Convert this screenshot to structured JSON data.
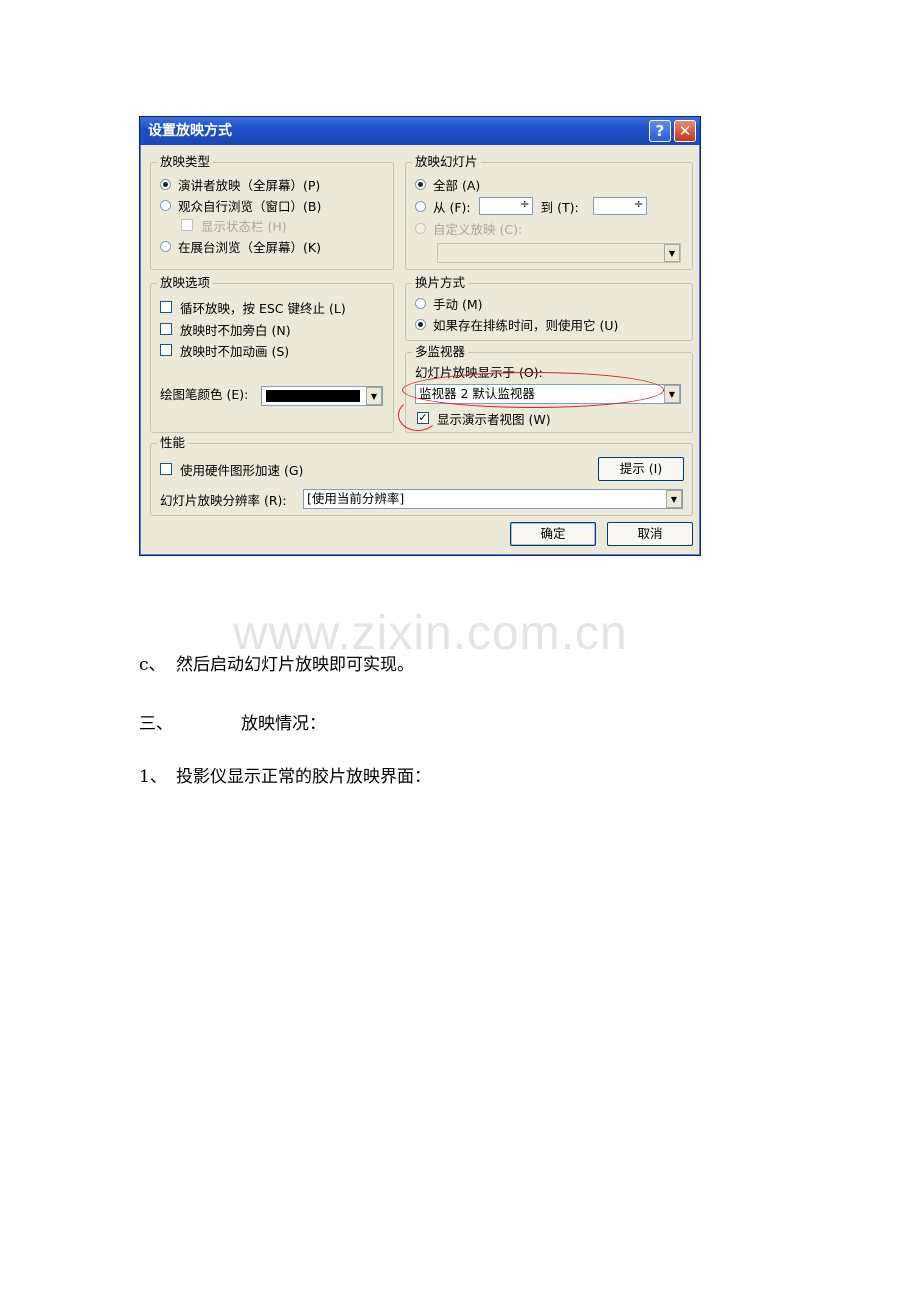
{
  "dialog": {
    "title": "设置放映方式",
    "help_glyph": "?",
    "close_glyph": "✕",
    "show_type": {
      "legend": "放映类型",
      "presenter": "演讲者放映（全屏幕）(P)",
      "browsed": "观众自行浏览（窗口）(B)",
      "show_status_bar": "显示状态栏 (H)",
      "kiosk": "在展台浏览（全屏幕）(K)"
    },
    "show_slides": {
      "legend": "放映幻灯片",
      "all": "全部 (A)",
      "from": "从 (F):",
      "to": "到 (T):",
      "custom": "自定义放映 (C):"
    },
    "show_options": {
      "legend": "放映选项",
      "loop": "循环放映，按 ESC 键终止 (L)",
      "no_narration": "放映时不加旁白 (N)",
      "no_animation": "放映时不加动画 (S)",
      "pen_color_label": "绘图笔颜色 (E):",
      "pen_color": "#000000"
    },
    "advance": {
      "legend": "换片方式",
      "manual": "手动 (M)",
      "timings": "如果存在排练时间，则使用它 (U)"
    },
    "multi_monitor": {
      "legend": "多监视器",
      "display_on_label": "幻灯片放映显示于 (O):",
      "display_on_value": "监视器 2  默认监视器",
      "presenter_view": "显示演示者视图 (W)"
    },
    "performance": {
      "legend": "性能",
      "hw_accel": "使用硬件图形加速 (G)",
      "tips_button": "提示 (I)",
      "resolution_label": "幻灯片放映分辨率 (R):",
      "resolution_value": "[使用当前分辨率]"
    },
    "ok_button": "确定",
    "cancel_button": "取消",
    "drop_arrow": "▼",
    "check_mark": "✓"
  },
  "watermark": "www.zixin.com.cn",
  "paragraphs": {
    "c_marker": "c、",
    "c_text": "然后启动幻灯片放映即可实现。",
    "three_marker": "三、",
    "three_text": "放映情况：",
    "one_marker": "1、",
    "one_text": "投影仪显示正常的胶片放映界面："
  }
}
